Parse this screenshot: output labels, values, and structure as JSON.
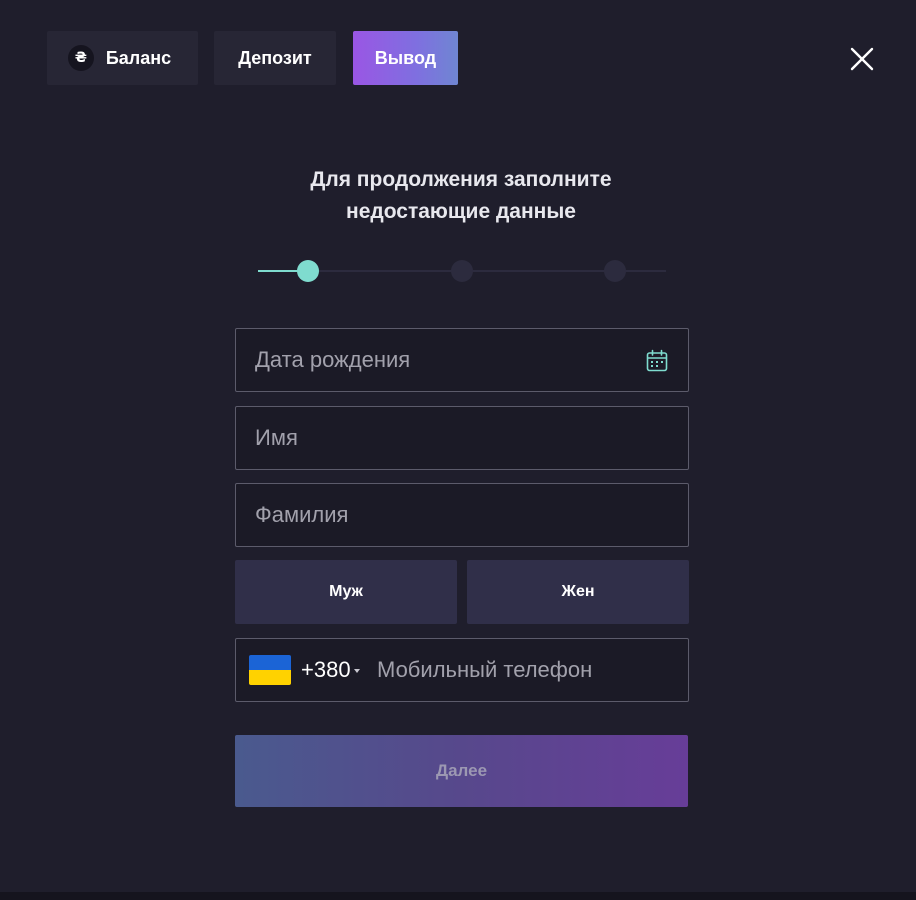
{
  "tabs": {
    "balance": {
      "label": "Баланс",
      "icon_glyph": "₴",
      "icon": "hryvnia-icon"
    },
    "deposit": {
      "label": "Депозит"
    },
    "withdraw": {
      "label": "Вывод",
      "active": true
    }
  },
  "title": {
    "line1": "Для продолжения заполните",
    "line2": "недостающие данные"
  },
  "stepper": {
    "current_step": 1,
    "total_steps": 3
  },
  "form": {
    "birthdate": {
      "value": "",
      "placeholder": "Дата рождения",
      "icon": "calendar-icon"
    },
    "first_name": {
      "value": "",
      "placeholder": "Имя"
    },
    "last_name": {
      "value": "",
      "placeholder": "Фамилия"
    },
    "gender": {
      "male_label": "Муж",
      "female_label": "Жен"
    },
    "phone": {
      "country_flag": "ua-flag-icon",
      "country_code": "+380",
      "value": "",
      "placeholder": "Мобильный телефон"
    },
    "next_label": "Далее"
  },
  "colors": {
    "background": "#1f1e2c",
    "accent_purple": "#9a56e4",
    "accent_teal": "#7fdccf",
    "field_border": "#5c5b6b",
    "gender_button": "#302f49"
  }
}
